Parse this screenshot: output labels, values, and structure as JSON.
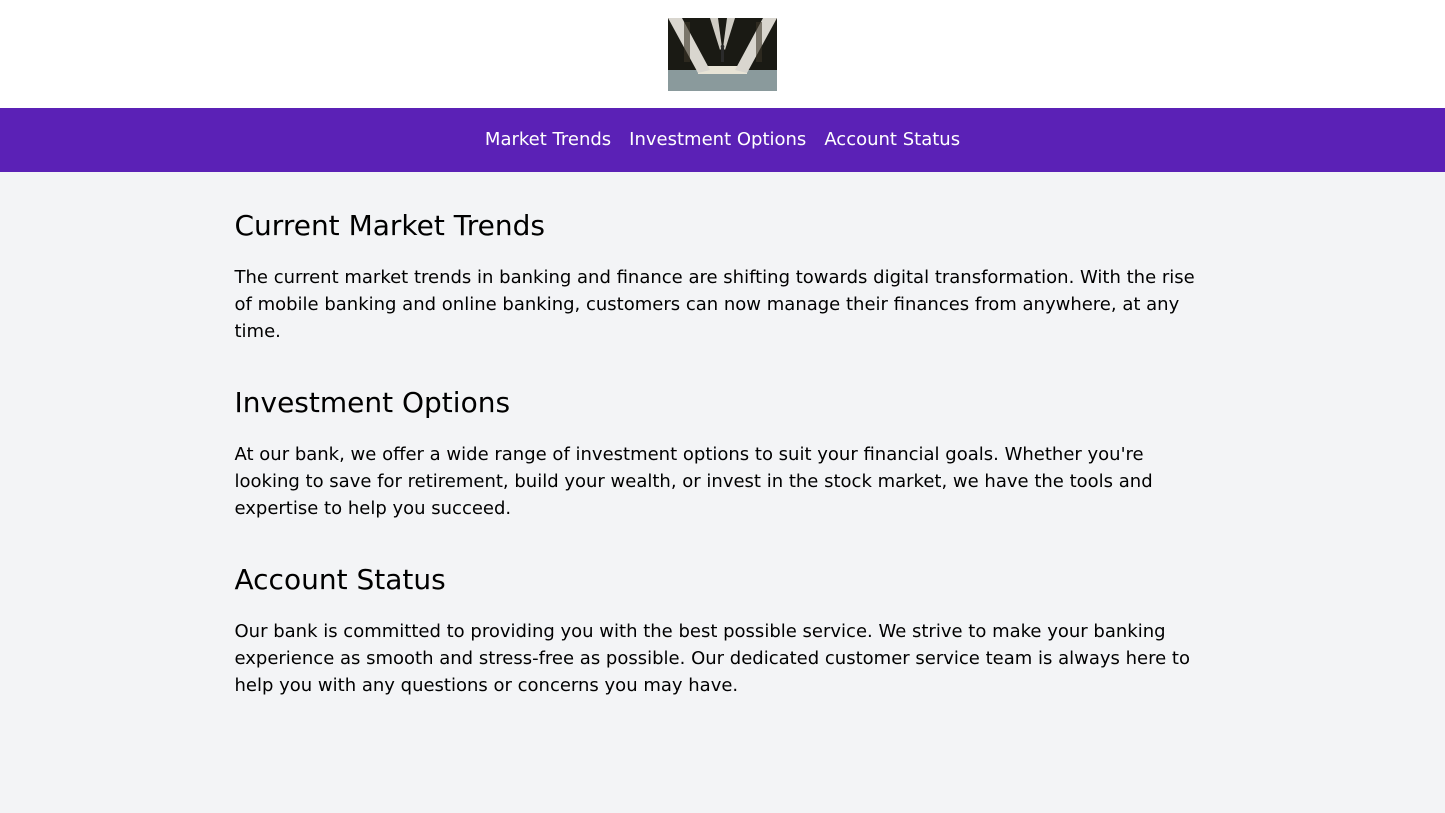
{
  "header": {
    "logo_icon": "building-photo-logo"
  },
  "nav": {
    "items": [
      {
        "label": "Market Trends"
      },
      {
        "label": "Investment Options"
      },
      {
        "label": "Account Status"
      }
    ]
  },
  "sections": [
    {
      "title": "Current Market Trends",
      "body": "The current market trends in banking and finance are shifting towards digital transformation. With the rise of mobile banking and online banking, customers can now manage their finances from anywhere, at any time."
    },
    {
      "title": "Investment Options",
      "body": "At our bank, we offer a wide range of investment options to suit your financial goals. Whether you're looking to save for retirement, build your wealth, or invest in the stock market, we have the tools and expertise to help you succeed."
    },
    {
      "title": "Account Status",
      "body": "Our bank is committed to providing you with the best possible service. We strive to make your banking experience as smooth and stress-free as possible. Our dedicated customer service team is always here to help you with any questions or concerns you may have."
    }
  ],
  "colors": {
    "nav_background": "#5b21b6",
    "page_background": "#f3f4f6",
    "header_background": "#ffffff"
  }
}
